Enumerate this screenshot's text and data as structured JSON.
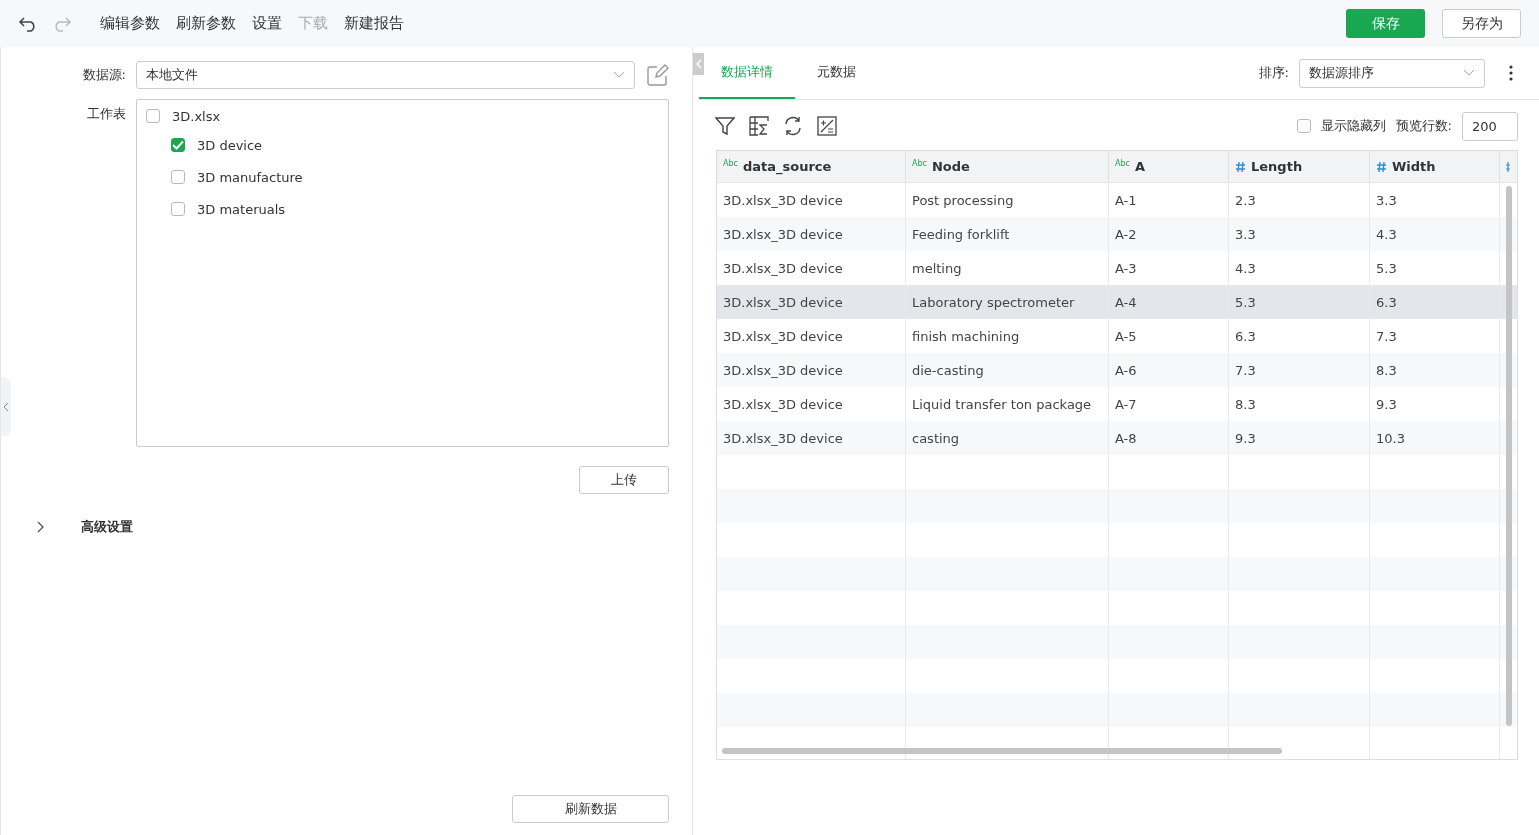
{
  "toolbar": {
    "undo": {
      "disabled": false
    },
    "redo": {
      "disabled": true
    },
    "menu": [
      {
        "label": "编辑参数",
        "disabled": false
      },
      {
        "label": "刷新参数",
        "disabled": false
      },
      {
        "label": "设置",
        "disabled": false
      },
      {
        "label": "下载",
        "disabled": true
      },
      {
        "label": "新建报告",
        "disabled": false
      }
    ],
    "save": "保存",
    "save_as": "另存为"
  },
  "left": {
    "datasource_label": "数据源:",
    "datasource_value": "本地文件",
    "worksheet_label": "工作表",
    "worksheets": [
      {
        "label": "3D.xlsx",
        "checked": false,
        "children": [
          {
            "label": "3D device",
            "checked": true
          },
          {
            "label": "3D manufacture",
            "checked": false
          },
          {
            "label": "3D materuals",
            "checked": false
          }
        ]
      }
    ],
    "upload": "上传",
    "advanced": {
      "label": "高级设置",
      "expanded": false
    },
    "refresh": "刷新数据"
  },
  "right": {
    "tabs": [
      {
        "label": "数据详情",
        "selected": true
      },
      {
        "label": "元数据",
        "selected": false
      }
    ],
    "sort_label": "排序:",
    "sort_value": "数据源排序",
    "show_hidden": {
      "label": "显示隐藏列",
      "checked": false
    },
    "preview_label": "预览行数:",
    "preview_value": "200",
    "table": {
      "columns": [
        {
          "label": "data_source",
          "kind": "text",
          "type_label": "Abc"
        },
        {
          "label": "Node",
          "kind": "text",
          "type_label": "Abc"
        },
        {
          "label": "A",
          "kind": "text",
          "type_label": "Abc"
        },
        {
          "label": "Length",
          "kind": "number"
        },
        {
          "label": "Width",
          "kind": "number"
        }
      ],
      "rows": [
        {
          "cells": [
            "3D.xlsx_3D device",
            "Post processing",
            "A-1",
            "2.3",
            "3.3"
          ],
          "selected": false
        },
        {
          "cells": [
            "3D.xlsx_3D device",
            "Feeding forklift",
            "A-2",
            "3.3",
            "4.3"
          ],
          "selected": false
        },
        {
          "cells": [
            "3D.xlsx_3D device",
            "melting",
            "A-3",
            "4.3",
            "5.3"
          ],
          "selected": false
        },
        {
          "cells": [
            "3D.xlsx_3D device",
            "Laboratory spectrometer",
            "A-4",
            "5.3",
            "6.3"
          ],
          "selected": true
        },
        {
          "cells": [
            "3D.xlsx_3D device",
            "finish machining",
            "A-5",
            "6.3",
            "7.3"
          ],
          "selected": false
        },
        {
          "cells": [
            "3D.xlsx_3D device",
            "die-casting",
            "A-6",
            "7.3",
            "8.3"
          ],
          "selected": false
        },
        {
          "cells": [
            "3D.xlsx_3D device",
            "Liquid transfer ton package",
            "A-7",
            "8.3",
            "9.3"
          ],
          "selected": false
        },
        {
          "cells": [
            "3D.xlsx_3D device",
            "casting",
            "A-8",
            "9.3",
            "10.3"
          ],
          "selected": false
        }
      ]
    }
  }
}
